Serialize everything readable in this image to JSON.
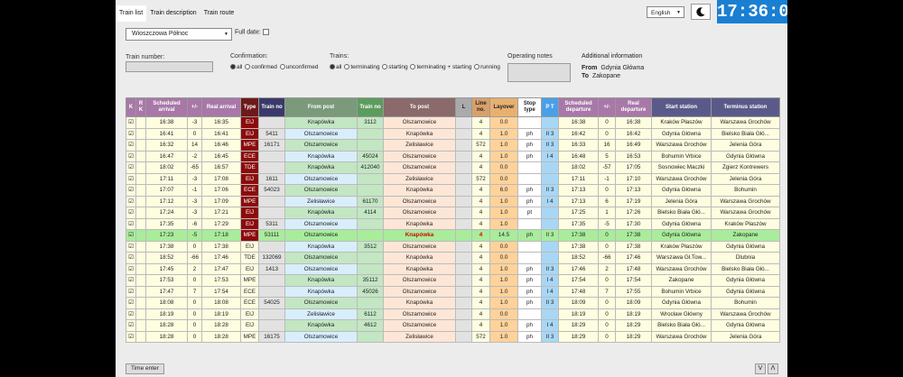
{
  "tabs": [
    "Train list",
    "Train description",
    "Train route"
  ],
  "language": "English",
  "clock": "17:36:03",
  "station": "Wioszczowa Północ",
  "full_date_label": "Full date:",
  "train_number_label": "Train number:",
  "confirmation": {
    "label": "Confirmation:",
    "options": [
      "all",
      "confirmed",
      "unconfirmed"
    ],
    "selected": "all"
  },
  "trains": {
    "label": "Trains:",
    "options": [
      "all",
      "terminating",
      "starting",
      "terminating + starting",
      "running"
    ],
    "selected": "all"
  },
  "operating_notes_label": "Operating notes",
  "additional_info": {
    "label": "Additional information",
    "from_label": "From",
    "from": "Gdynia Główna",
    "to_label": "To",
    "to": "Zakopane"
  },
  "columns": [
    "K",
    "R K",
    "Scheduled arrival",
    "+/-",
    "Real arrival",
    "Type",
    "Train no",
    "From post",
    "Train no",
    "To post",
    "L",
    "Line no.",
    "Layover",
    "Stop type",
    "P T",
    "Scheduled departure",
    "+/-",
    "Real departure",
    "Start station",
    "Terminus station"
  ],
  "rows": [
    [
      "☑",
      "",
      "16:38",
      "-3",
      "16:35",
      "EIJ",
      "",
      "Knapówka",
      "3112",
      "Olszamowice",
      "",
      "4",
      "0.0",
      "",
      "",
      "16:38",
      "0",
      "16:38",
      "Kraków Płaszów",
      "Warszawa Grochów"
    ],
    [
      "☑",
      "",
      "16:41",
      "0",
      "16:41",
      "EIJ",
      "5411",
      "Olszamowice",
      "",
      "Knapówka",
      "",
      "4",
      "1.0",
      "ph",
      "II 3",
      "16:42",
      "0",
      "16:42",
      "Gdynia Główna",
      "Bielsko Biała Głó..."
    ],
    [
      "☑",
      "",
      "16:32",
      "14",
      "16:46",
      "MPE",
      "16171",
      "Olszamowice",
      "",
      "Zelisławice",
      "",
      "572",
      "1.0",
      "ph",
      "II 3",
      "16:33",
      "16",
      "16:49",
      "Warszawa Grochów",
      "Jelenia Góra"
    ],
    [
      "☑",
      "",
      "16:47",
      "-2",
      "16:45",
      "ECE",
      "",
      "Knapówka",
      "45024",
      "Olszamowice",
      "",
      "4",
      "1.0",
      "ph",
      "I 4",
      "16:48",
      "5",
      "16:53",
      "Bohumin Vrbice",
      "Gdynia Główna"
    ],
    [
      "☑",
      "",
      "18:02",
      "-65",
      "16:57",
      "TDE",
      "",
      "Knapówka",
      "412040",
      "Olszamowice",
      "",
      "4",
      "0.0",
      "",
      "",
      "18:02",
      "-57",
      "17:05",
      "Sosnowiec Maczki",
      "Zgierz Kontrewers"
    ],
    [
      "☑",
      "",
      "17:11",
      "-3",
      "17:08",
      "EIJ",
      "1611",
      "Olszamowice",
      "",
      "Zelisławice",
      "",
      "572",
      "0.0",
      "",
      "",
      "17:11",
      "-1",
      "17:10",
      "Warszawa Grochów",
      "Jelenia Góra"
    ],
    [
      "☑",
      "",
      "17:07",
      "-1",
      "17:06",
      "ECE",
      "54023",
      "Olszamowice",
      "",
      "Knapówka",
      "",
      "4",
      "6.0",
      "ph",
      "II 3",
      "17:13",
      "0",
      "17:13",
      "Gdynia Główna",
      "Bohumin"
    ],
    [
      "☑",
      "",
      "17:12",
      "-3",
      "17:09",
      "MPE",
      "",
      "Zelisławice",
      "61170",
      "Olszamowice",
      "",
      "4",
      "1.0",
      "ph",
      "I 4",
      "17:13",
      "6",
      "17:19",
      "Jelenia Góra",
      "Warszawa Grochów"
    ],
    [
      "☑",
      "",
      "17:24",
      "-3",
      "17:21",
      "EIJ",
      "",
      "Knapówka",
      "4114",
      "Olszamowice",
      "",
      "4",
      "1.0",
      "pt",
      "",
      "17:25",
      "1",
      "17:26",
      "Bielsko Biała Głó...",
      "Warszawa Grochów"
    ],
    [
      "☑",
      "",
      "17:35",
      "-6",
      "17:29",
      "EIJ",
      "5311",
      "Olszamowice",
      "",
      "Knapówka",
      "",
      "4",
      "1.0",
      "",
      "",
      "17:35",
      "-5",
      "17:30",
      "Gdynia Główna",
      "Kraków Płaszów"
    ],
    [
      "☑",
      "",
      "17:23",
      "-5",
      "17:18",
      "MPE",
      "53111",
      "Olszamowice",
      "",
      "Knapówka",
      "",
      "4",
      "14.5",
      "ph",
      "II 3",
      "17:38",
      "0",
      "17:38",
      "Gdynia Główna",
      "Zakopane"
    ],
    [
      "☑",
      "",
      "17:38",
      "0",
      "17:38",
      "EIJ",
      "",
      "Knapówka",
      "3512",
      "Olszamowice",
      "",
      "4",
      "0.0",
      "",
      "",
      "17:38",
      "0",
      "17:38",
      "Kraków Płaszów",
      "Gdynia Główna"
    ],
    [
      "☑",
      "",
      "18:52",
      "-66",
      "17:46",
      "TDE",
      "132069",
      "Olszamowice",
      "",
      "Knapówka",
      "",
      "4",
      "0.0",
      "",
      "",
      "18:52",
      "-66",
      "17:46",
      "Warszawa Gł.Tow...",
      "Dlubnia"
    ],
    [
      "☑",
      "",
      "17:45",
      "2",
      "17:47",
      "EIJ",
      "1413",
      "Olszamowice",
      "",
      "Knapówka",
      "",
      "4",
      "1.0",
      "ph",
      "II 3",
      "17:46",
      "2",
      "17:48",
      "Warszawa Grochów",
      "Bielsko Biała Głó..."
    ],
    [
      "☑",
      "",
      "17:53",
      "0",
      "17:53",
      "MPE",
      "",
      "Knapówka",
      "35112",
      "Olszamowice",
      "",
      "4",
      "1.0",
      "ph",
      "I 4",
      "17:54",
      "0",
      "17:54",
      "Zakopane",
      "Gdynia Główna"
    ],
    [
      "☑",
      "",
      "17:47",
      "7",
      "17:54",
      "ECE",
      "",
      "Knapówka",
      "45026",
      "Olszamowice",
      "",
      "4",
      "1.0",
      "ph",
      "I 4",
      "17:48",
      "7",
      "17:55",
      "Bohumin Vrbice",
      "Gdynia Główna"
    ],
    [
      "☑",
      "",
      "18:08",
      "0",
      "18:08",
      "ECE",
      "54025",
      "Olszamowice",
      "",
      "Knapówka",
      "",
      "4",
      "1.0",
      "ph",
      "II 3",
      "18:09",
      "0",
      "18:09",
      "Gdynia Główna",
      "Bohumin"
    ],
    [
      "☑",
      "",
      "18:19",
      "0",
      "18:19",
      "EIJ",
      "",
      "Zelisławice",
      "6112",
      "Olszamowice",
      "",
      "4",
      "0.0",
      "",
      "",
      "18:19",
      "0",
      "18:19",
      "Wrocław Główny",
      "Warszawa Grochów"
    ],
    [
      "☑",
      "",
      "18:28",
      "0",
      "18:28",
      "EIJ",
      "",
      "Knapówka",
      "4612",
      "Olszamowice",
      "",
      "4",
      "1.0",
      "ph",
      "I 4",
      "18:29",
      "0",
      "18:29",
      "Bielsko Biała Głó...",
      "Gdynia Główna"
    ],
    [
      "☑",
      "",
      "18:28",
      "0",
      "18:28",
      "MPE",
      "16175",
      "Olszamowice",
      "",
      "Zelisławice",
      "",
      "572",
      "1.0",
      "ph",
      "II 3",
      "18:29",
      "0",
      "18:29",
      "Warszawa Grochów",
      "Jelenia Góra"
    ]
  ],
  "highlighted_row": 10,
  "time_enter_label": "Time enter",
  "nav_down": "V",
  "nav_up": "Λ"
}
